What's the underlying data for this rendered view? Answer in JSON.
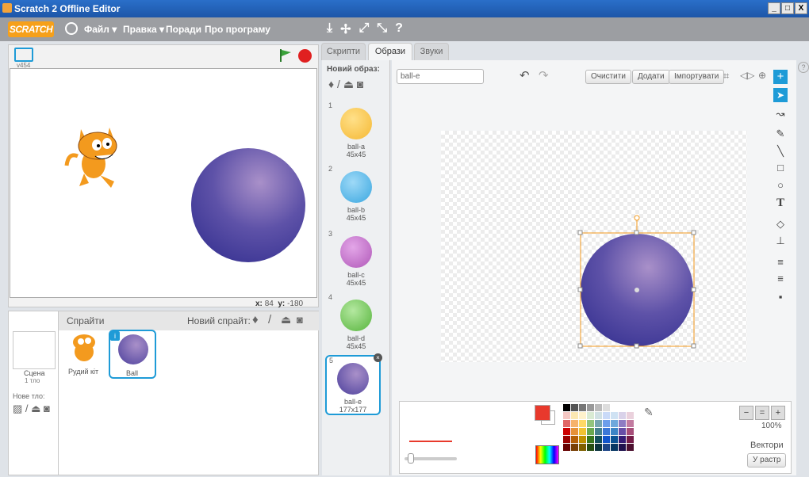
{
  "window": {
    "title": "Scratch 2 Offline Editor",
    "buttons": [
      "_",
      "□",
      "X"
    ]
  },
  "menubar": {
    "logo": "SCRATCH",
    "file": "Файл ▾",
    "edit": "Правка ▾",
    "tips": "Поради",
    "about": "Про програму",
    "tool_icons": [
      "duplicate-icon",
      "cut-icon",
      "grow-icon",
      "shrink-icon",
      "help-icon"
    ]
  },
  "stage": {
    "version": "v454",
    "coords_x_label": "x:",
    "coords_x": "84",
    "coords_y_label": "y:",
    "coords_y": "-180"
  },
  "sprites": {
    "title": "Спрайти",
    "new_sprite": "Новий спрайт:",
    "scene_label": "Сцена",
    "scene_sub": "1 тло",
    "new_backdrop": "Нове тло:",
    "items": [
      {
        "name": "Рудий кіт"
      },
      {
        "name": "Ball"
      }
    ]
  },
  "tabs": [
    {
      "label": "Скрипти"
    },
    {
      "label": "Образи"
    },
    {
      "label": "Звуки"
    }
  ],
  "costumes": {
    "new_label": "Новий образ:",
    "items": [
      {
        "num": "1",
        "name": "ball-a",
        "size": "45x45",
        "color": "#f5b833"
      },
      {
        "num": "2",
        "name": "ball-b",
        "size": "45x45",
        "color": "#3aa7e0"
      },
      {
        "num": "3",
        "name": "ball-c",
        "size": "45x45",
        "color": "#b058b8"
      },
      {
        "num": "4",
        "name": "ball-d",
        "size": "45x45",
        "color": "#56b43c"
      },
      {
        "num": "5",
        "name": "ball-e",
        "size": "177x177",
        "color": "#5a4ba6"
      }
    ]
  },
  "editor": {
    "costume_name": "ball-e",
    "clear": "Очистити",
    "add": "Додати",
    "import": "Імпортувати",
    "zoom": "100%",
    "mode": "Вектори",
    "convert": "У растр"
  },
  "colors": {
    "accent": "#1e9bd7",
    "primary_fill": "#e8392c",
    "ball": "#5a4ba6"
  }
}
